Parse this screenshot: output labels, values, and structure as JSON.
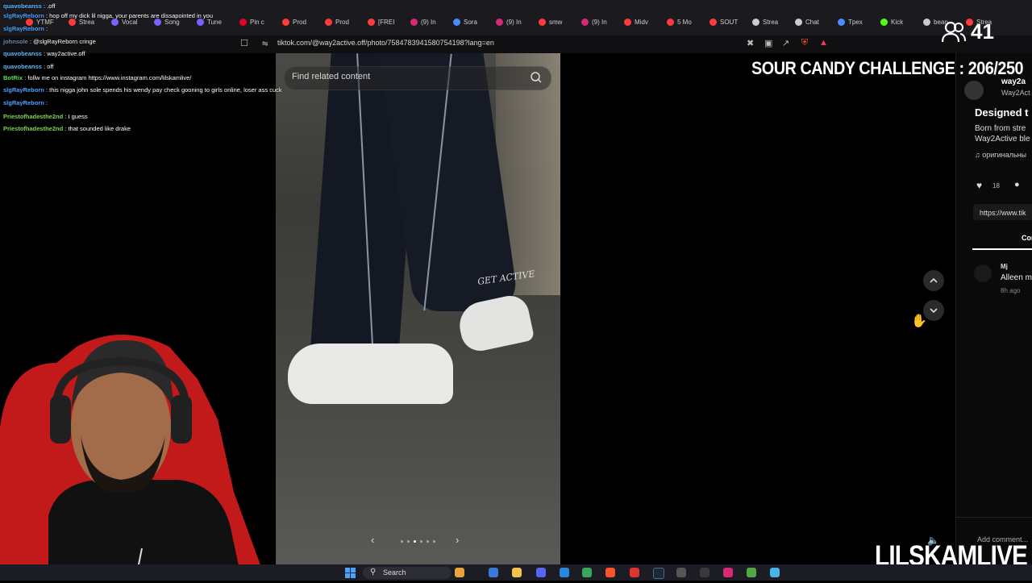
{
  "browser": {
    "tabs": [
      {
        "label": "YTMF",
        "color": "#ff3b3b"
      },
      {
        "label": "Strea",
        "color": "#ff3b3b"
      },
      {
        "label": "Vocal",
        "color": "#7b61ff"
      },
      {
        "label": "Song",
        "color": "#7b61ff"
      },
      {
        "label": "Tune",
        "color": "#7b61ff"
      },
      {
        "label": "Pin c",
        "color": "#e60023"
      },
      {
        "label": "Prod",
        "color": "#ff3b3b"
      },
      {
        "label": "Prod",
        "color": "#ff3b3b"
      },
      {
        "label": "[FREI",
        "color": "#ff3b3b"
      },
      {
        "label": "(9) In",
        "color": "#d62976"
      },
      {
        "label": "Sora",
        "color": "#4a8cff"
      },
      {
        "label": "(9) In",
        "color": "#d62976"
      },
      {
        "label": "smw",
        "color": "#ff3b3b"
      },
      {
        "label": "(9) In",
        "color": "#d62976"
      },
      {
        "label": "Midv",
        "color": "#ff3b3b"
      },
      {
        "label": "5 Mo",
        "color": "#ff3b3b"
      },
      {
        "label": "SOUT",
        "color": "#ff3b3b"
      },
      {
        "label": "Strea",
        "color": "#cccccc"
      },
      {
        "label": "Chat",
        "color": "#cccccc"
      },
      {
        "label": "Tpex",
        "color": "#4a8cff"
      },
      {
        "label": "Kick",
        "color": "#53fc18"
      },
      {
        "label": "bean",
        "color": "#cccccc"
      },
      {
        "label": "Strea",
        "color": "#ff3b3b"
      }
    ],
    "url": "tiktok.com/@way2active.off/photo/7584783941580754198?lang=en"
  },
  "page": {
    "search_placeholder": "Find related content",
    "shoe_print": "GET ACTIVE",
    "carousel_prev": "‹",
    "carousel_next": "›",
    "nav_up": "⌃",
    "nav_down": "⌄"
  },
  "panel": {
    "handle": "way2a",
    "handle_sub": "Way2Act",
    "title": "Designed t",
    "desc_1": "Born from stre",
    "desc_2": "Way2Active ble",
    "sound": "♫ оригинальны",
    "likes": "18",
    "link": "https://www.tik",
    "tab": "Comm",
    "comment_user": "Mj",
    "comment_text": "Alleen m",
    "comment_time": "8h ago",
    "add_comment": "Add comment..."
  },
  "chat": [
    {
      "name": "quavobeanss",
      "name_color": "#58b9ff",
      "text": ": .off"
    },
    {
      "name": "slgRayReborn",
      "name_color": "#4aa3ff",
      "text": ": hop off my dick lil nigga, your parents are dissapointed in you"
    },
    {
      "name": "slgRayReborn",
      "name_color": "#4aa3ff",
      "text": ":"
    },
    {
      "name": "johnsole",
      "name_color": "#6c8ab0",
      "text": ": @slgRayReborn cringe"
    },
    {
      "name": "quavobeanss",
      "name_color": "#58b9ff",
      "text": ": way2active.off"
    },
    {
      "name": "quavobeanss",
      "name_color": "#58b9ff",
      "text": ": off"
    },
    {
      "name": "BotRix",
      "name_color": "#56e04b",
      "text": ": follw me on instagram https://www.instagram.com/lilskamlive/"
    },
    {
      "name": "slgRayReborn",
      "name_color": "#4aa3ff",
      "text": ": this nigga john sole spends his wendy pay check gooning to girls online, loser ass cuck"
    },
    {
      "name": "slgRayReborn",
      "name_color": "#4aa3ff",
      "text": ":"
    },
    {
      "name": "Priestofhadesthe2nd",
      "name_color": "#7cd64a",
      "text": ": I guess"
    },
    {
      "name": "Priestofhadesthe2nd",
      "name_color": "#7cd64a",
      "text": ": that sounded like drake"
    }
  ],
  "overlay": {
    "challenge": "SOUR CANDY CHALLENGE : 206/250",
    "viewer_count": "41",
    "brand": "LILSKAMLIVE"
  },
  "taskbar": {
    "search_label": "Search"
  }
}
